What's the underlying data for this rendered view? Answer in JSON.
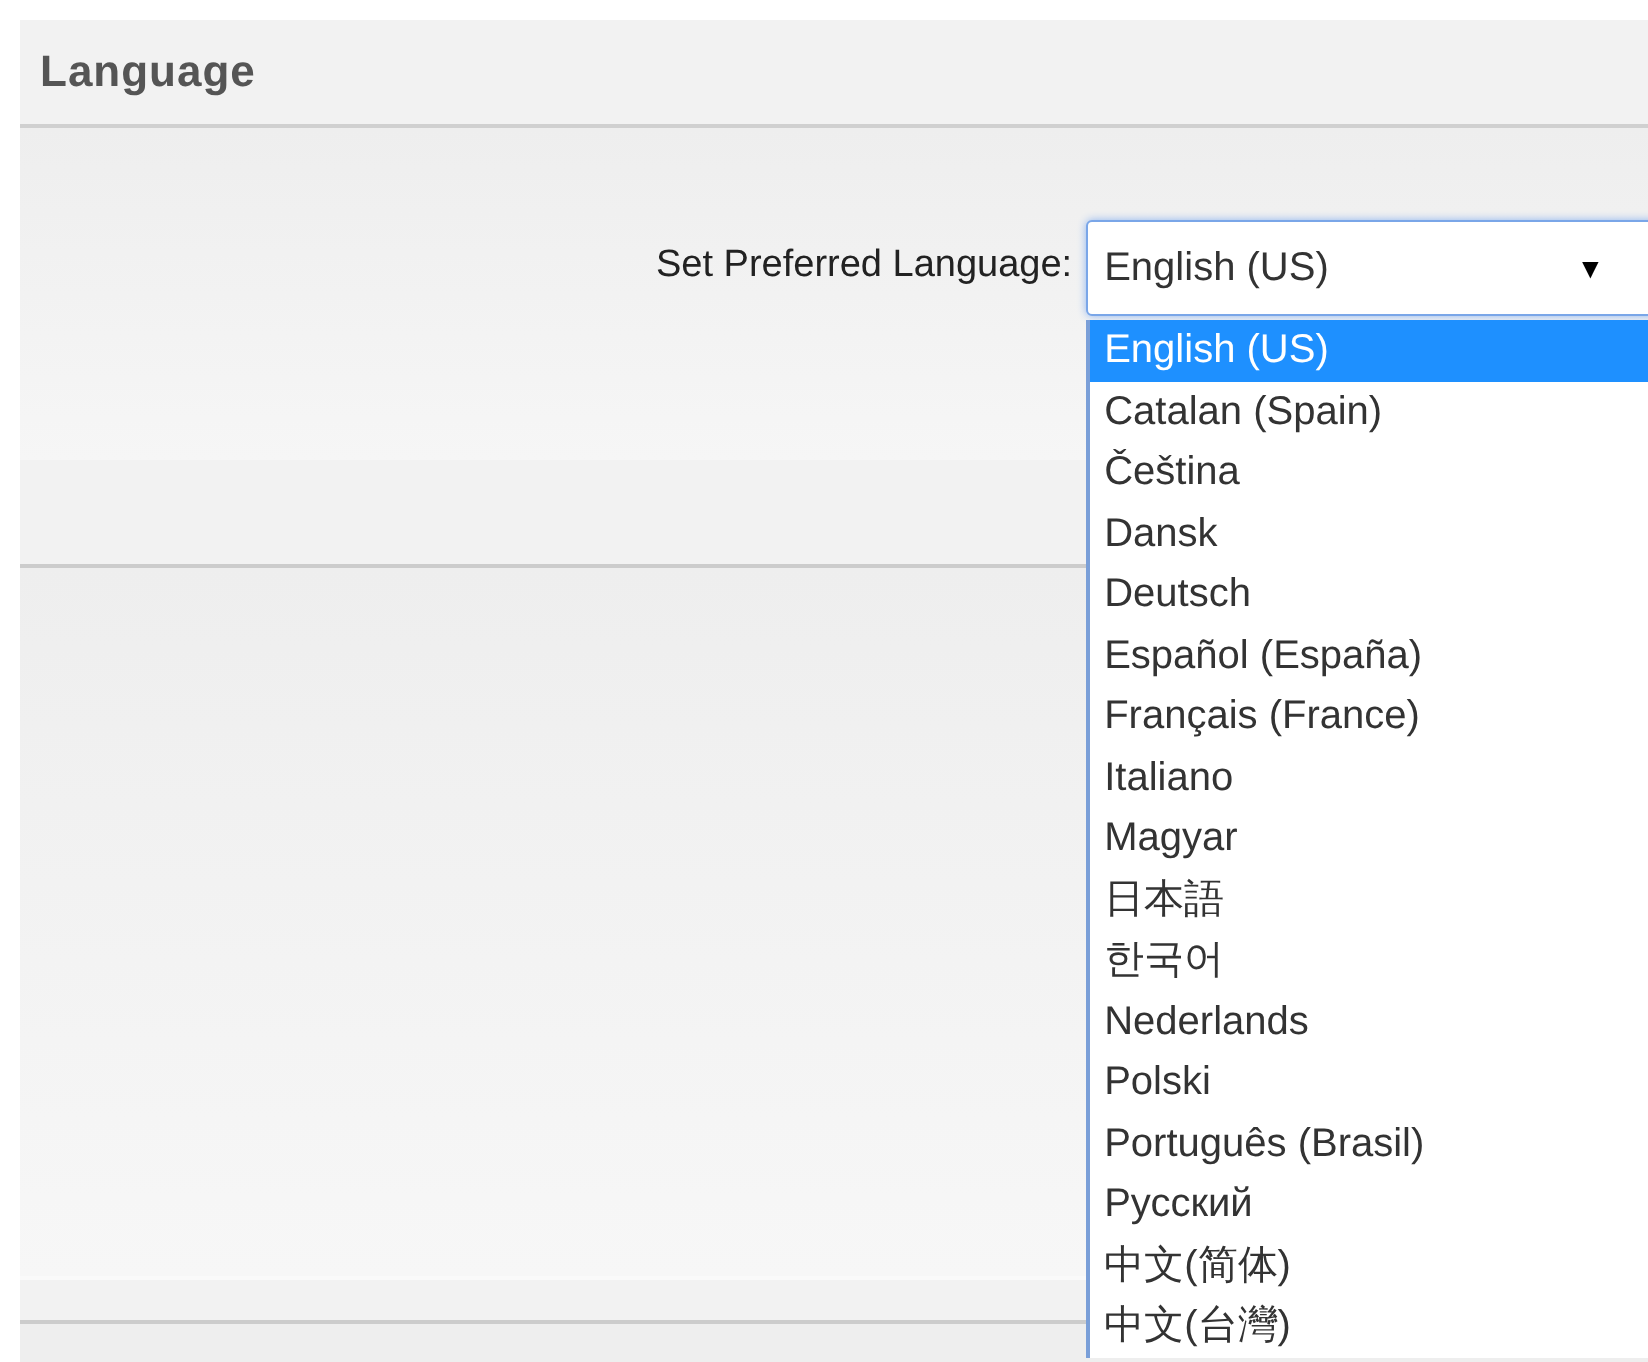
{
  "section": {
    "title": "Language"
  },
  "form": {
    "label": "Set Preferred Language:",
    "select": {
      "value": "English (US)",
      "expanded": true,
      "arrow": "▼"
    }
  },
  "options": [
    {
      "label": "English (US)",
      "selected": true
    },
    {
      "label": "Catalan (Spain)",
      "selected": false
    },
    {
      "label": "Čeština",
      "selected": false
    },
    {
      "label": "Dansk",
      "selected": false
    },
    {
      "label": "Deutsch",
      "selected": false
    },
    {
      "label": "Español (España)",
      "selected": false
    },
    {
      "label": "Français (France)",
      "selected": false
    },
    {
      "label": "Italiano",
      "selected": false
    },
    {
      "label": "Magyar",
      "selected": false
    },
    {
      "label": "日本語",
      "selected": false
    },
    {
      "label": "한국어",
      "selected": false
    },
    {
      "label": "Nederlands",
      "selected": false
    },
    {
      "label": "Polski",
      "selected": false
    },
    {
      "label": "Português (Brasil)",
      "selected": false
    },
    {
      "label": "Русский",
      "selected": false
    },
    {
      "label": "中文(简体)",
      "selected": false
    },
    {
      "label": "中文(台灣)",
      "selected": false
    }
  ]
}
